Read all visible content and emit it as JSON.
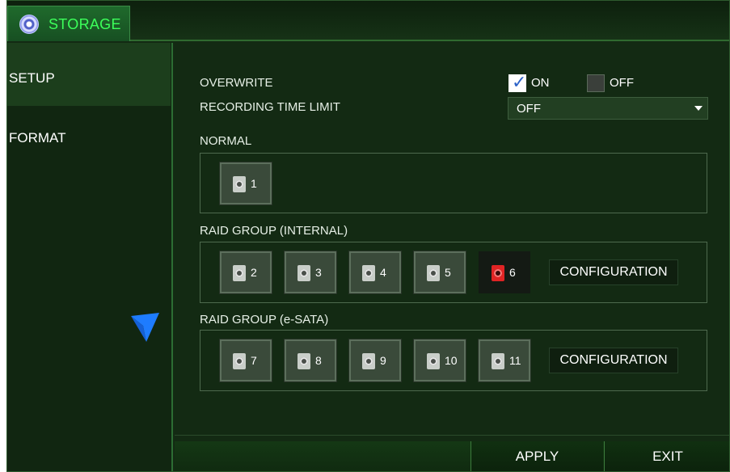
{
  "window": {
    "title": "STORAGE",
    "title_icon": "disc-icon"
  },
  "sidebar": {
    "items": [
      {
        "label": "SETUP",
        "selected": true
      },
      {
        "label": "FORMAT",
        "selected": false
      }
    ]
  },
  "setup": {
    "overwrite": {
      "label": "OVERWRITE",
      "on_label": "ON",
      "off_label": "OFF",
      "on_checked": true,
      "off_checked": false
    },
    "recording_time_limit": {
      "label": "RECORDING TIME LIMIT",
      "value": "OFF"
    },
    "normal": {
      "label": "NORMAL",
      "disks": [
        "1"
      ]
    },
    "raid_internal": {
      "label": "RAID GROUP (INTERNAL)",
      "disks": [
        "2",
        "3",
        "4",
        "5",
        "6"
      ],
      "error_disk": "6",
      "configuration_label": "CONFIGURATION"
    },
    "raid_esata": {
      "label": "RAID GROUP (e-SATA)",
      "disks": [
        "7",
        "8",
        "9",
        "10",
        "11"
      ],
      "configuration_label": "CONFIGURATION"
    }
  },
  "footer": {
    "apply_label": "APPLY",
    "exit_label": "EXIT"
  },
  "colors": {
    "title_text": "#3cff5a",
    "background": "#132a13",
    "accent_border": "#2c6d33",
    "disk_error": "#e02424",
    "checkbox_tick": "#2d63c8",
    "cursor": "#1e7cff"
  }
}
